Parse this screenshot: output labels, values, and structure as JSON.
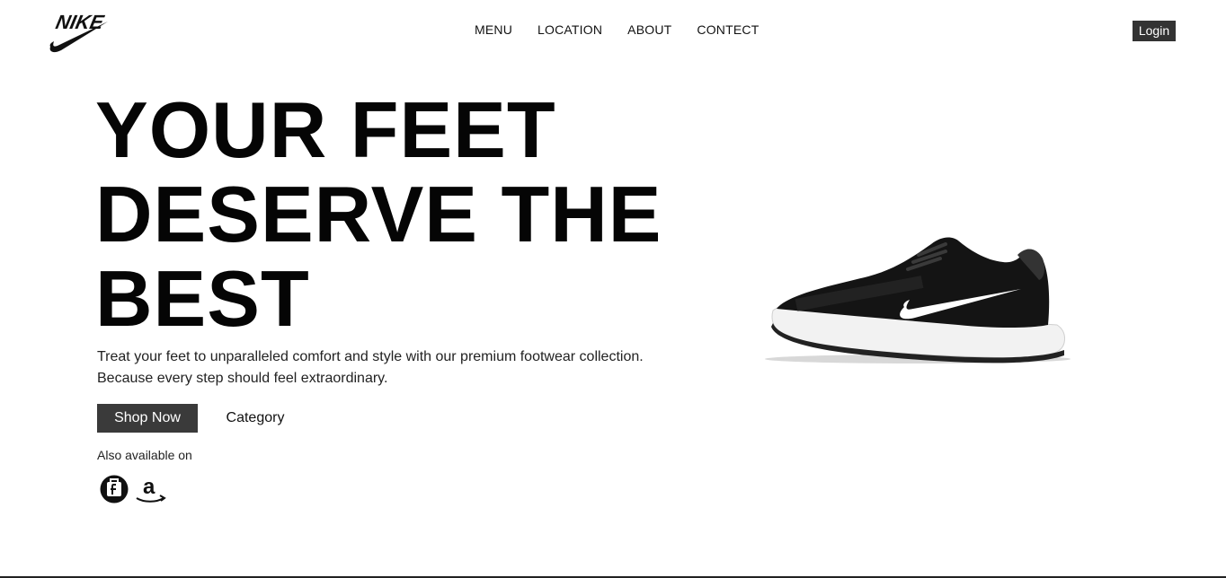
{
  "brand": {
    "logo_text": "NIKE",
    "logo_icon": "nike-swoosh-icon"
  },
  "nav": {
    "items": [
      {
        "label": "MENU"
      },
      {
        "label": "LOCATION"
      },
      {
        "label": "ABOUT"
      },
      {
        "label": "CONTECT"
      }
    ]
  },
  "header": {
    "login_label": "Login"
  },
  "hero": {
    "title_lines": [
      "YOUR FEET",
      "DESERVE THE",
      "BEST"
    ],
    "description_lines": [
      "Treat your feet to unparalleled comfort and style with our premium footwear collection.",
      "Because every step should feel extraordinary."
    ],
    "primary_button": "Shop Now",
    "secondary_button": "Category",
    "also_available": "Also available on",
    "stores": [
      {
        "icon": "flipkart-icon"
      },
      {
        "icon": "amazon-icon"
      }
    ]
  },
  "colors": {
    "accent_dark": "#3a3a3a",
    "text": "#111111",
    "background": "#ffffff"
  }
}
